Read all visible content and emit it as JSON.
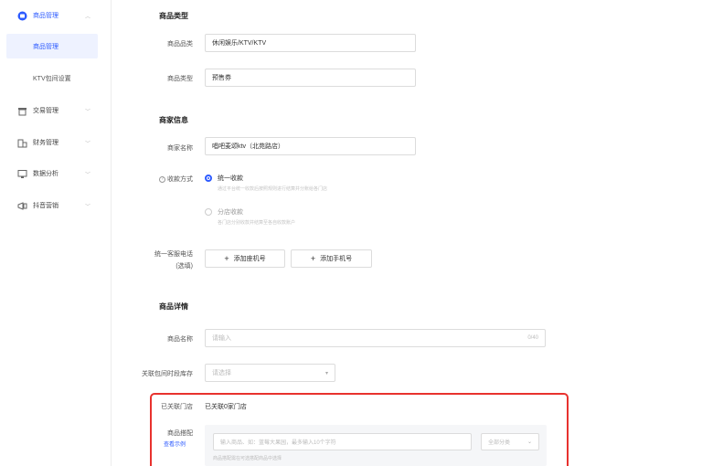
{
  "sidebar": {
    "groups": [
      {
        "label": "商品管理",
        "icon": "product-icon"
      },
      {
        "label": "交易管理",
        "icon": "trade-icon"
      },
      {
        "label": "财务管理",
        "icon": "finance-icon"
      },
      {
        "label": "数据分析",
        "icon": "data-icon"
      },
      {
        "label": "抖音营销",
        "icon": "marketing-icon"
      }
    ],
    "sub_items": [
      {
        "label": "商品管理"
      },
      {
        "label": "KTV包间设置"
      }
    ]
  },
  "product_type": {
    "section_title": "商品类型",
    "category_label": "商品品类",
    "category_value": "休闲娱乐/KTV/KTV",
    "type_label": "商品类型",
    "type_value": "预售券"
  },
  "merchant": {
    "section_title": "商家信息",
    "name_label": "商家名称",
    "name_value": "唱吧麦颂ktv（北苑路店）",
    "payment_label": "收款方式",
    "payment_options": [
      {
        "label": "统一收款",
        "desc": "通过平台统一收款后按照规则进行结算并分账给各门店"
      },
      {
        "label": "分店收款",
        "desc": "各门店分别收款并结算至各自收款账户"
      }
    ],
    "phone_label_line1": "统一客服电话",
    "phone_label_line2": "(选填)",
    "add_landline": "添加座机号",
    "add_mobile": "添加手机号"
  },
  "details": {
    "section_title": "商品详情",
    "name_label": "商品名称",
    "name_placeholder": "请输入",
    "name_counter": "0/40",
    "period_label": "关联包间时段库存",
    "period_placeholder": "请选择",
    "linked_label": "已关联门店",
    "linked_value": "已关联0家门店",
    "match_label": "商品搭配",
    "match_link": "查看示例",
    "search_placeholder": "输入商品、如：蓝莓大果园，最多输入10个字符",
    "search_select": "全部分类",
    "search_hint": "商品搭配需在可选搭配商品中选择"
  }
}
